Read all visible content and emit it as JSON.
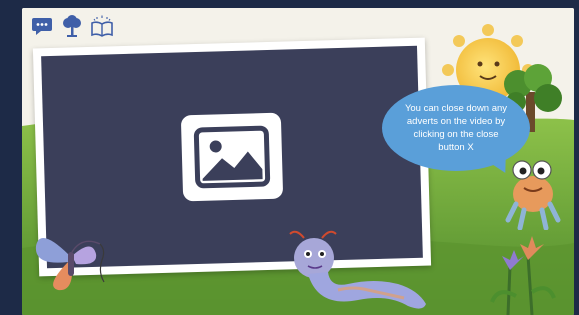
{
  "toolbar": {
    "icons": [
      "chat-bubble-icon",
      "tree-icon",
      "book-icon"
    ]
  },
  "video": {
    "placeholder_icon": "image-icon"
  },
  "speech_bubble": {
    "text": "You can close down any adverts on the video by clicking on the close button X"
  },
  "colors": {
    "page_background": "#1d2a47",
    "video_screen": "#3b3f5a",
    "speech_bubble": "#5a9fd9",
    "grass": "#6fa23a",
    "sun": "#f5c542",
    "toolbar_icon": "#3f5fa8"
  }
}
